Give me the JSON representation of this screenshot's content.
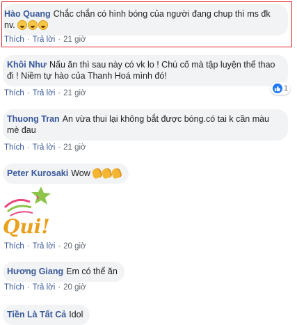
{
  "actions": {
    "like": "Thích",
    "reply": "Trả lời",
    "separator": "·"
  },
  "comments": [
    {
      "author": "Hào Quang",
      "text": "Chắc chắn có hình bóng của người đang chup thì ms đk nv.",
      "time": "21 giờ",
      "emoji": [
        "laughing-face-icon",
        "laughing-face-icon",
        "laughing-face-icon"
      ]
    },
    {
      "author": "Khôi Như",
      "text": "Nấu ăn thì sau này có vk lo ! Chú cố mà tập luyện thể thao đi ! Niềm tự hào của Thanh Hoá mình đó!",
      "time": "21 giờ",
      "reactions": "1"
    },
    {
      "author": "Thuong Tran",
      "text": "An vừa thui lại không bắt được bóng.có tai k cần màu mè đau",
      "time": "21 giờ"
    },
    {
      "author": "Peter Kurosaki",
      "text": "Wow",
      "emoji": [
        "clapping-hands-icon",
        "clapping-hands-icon",
        "clapping-hands-icon"
      ]
    },
    {
      "sticker": "Qui!",
      "time": "20 giờ"
    },
    {
      "author": "Hương Giang",
      "text": "Em có thể ăn",
      "time": "20 giờ"
    },
    {
      "author": "Tiền Là Tất Cả",
      "text": "Idol"
    }
  ],
  "colors": {
    "author": "#385898",
    "bubble": "#f2f3f5",
    "highlight_border": "#e4252b",
    "like_blue": "#2078f4"
  }
}
